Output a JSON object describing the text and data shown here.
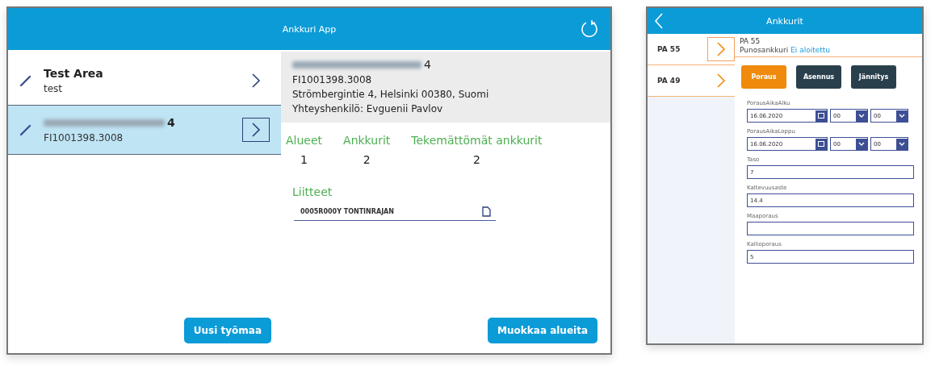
{
  "main_window": {
    "title": "Ankkuri App",
    "sites": [
      {
        "title": "Test Area",
        "subtitle": "test",
        "blurred_title": false,
        "selected": false
      },
      {
        "subtitle": "FI1001398.3008",
        "blurred_title": true,
        "title_suffix": "4",
        "selected": true
      }
    ],
    "new_site_button": "Uusi työmaa",
    "detail": {
      "title_suffix": "4",
      "code": "FI1001398.3008",
      "address": "Strömbergintie 4, Helsinki  00380, Suomi",
      "contact": "Yhteyshenkilö: Evguenii Pavlov"
    },
    "stats": [
      {
        "label": "Alueet",
        "value": "1"
      },
      {
        "label": "Ankkurit",
        "value": "2"
      },
      {
        "label": "Tekemättömät ankkurit",
        "value": "2"
      }
    ],
    "attachments_title": "Liitteet",
    "attachments": [
      "0005R000Y TONTINRAJAN"
    ],
    "edit_button": "Muokkaa alueita"
  },
  "anchor_window": {
    "title": "Ankkurit",
    "anchors": [
      {
        "label": "PA 55",
        "selected": true
      },
      {
        "label": "PA 49",
        "selected": false
      }
    ],
    "anchor_name": "PA 55",
    "anchor_type": "Punosankkuri",
    "anchor_status": "Ei aloitettu",
    "phase_tabs": [
      {
        "label": "Poraus",
        "selected": true
      },
      {
        "label": "Asennus",
        "selected": false
      },
      {
        "label": "Jännitys",
        "selected": false
      }
    ],
    "fields": [
      {
        "kind": "datetime",
        "label": "PorausAikaAlku",
        "date": "16.06.2020",
        "hour": "00",
        "minute": "00"
      },
      {
        "kind": "datetime",
        "label": "PorausAikaLoppu",
        "date": "16.06.2020",
        "hour": "00",
        "minute": "00"
      },
      {
        "kind": "text",
        "label": "Taso",
        "value": "7"
      },
      {
        "kind": "text",
        "label": "Kaltevuusaste",
        "value": "14.4"
      },
      {
        "kind": "text",
        "label": "Maaporaus"
      },
      {
        "kind": "text",
        "label": "Kallioporaus",
        "value": "5"
      }
    ]
  }
}
